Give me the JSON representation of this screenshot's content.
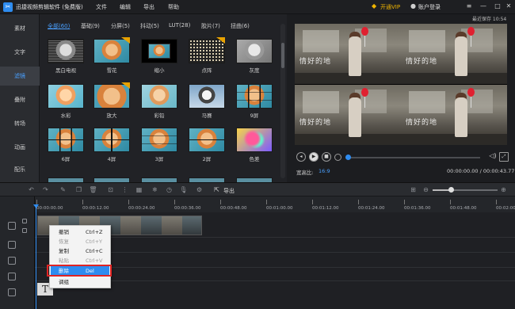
{
  "app": {
    "title": "迅捷视频剪辑软件 (免费版)",
    "menus": [
      "文件",
      "编辑",
      "导出",
      "帮助"
    ],
    "vip": "开通VIP",
    "login": "账户登录",
    "save_status": "最近保存 10:54"
  },
  "sidebar": {
    "items": [
      {
        "label": "素材"
      },
      {
        "label": "文字"
      },
      {
        "label": "滤镜",
        "active": true
      },
      {
        "label": "叠附"
      },
      {
        "label": "转场"
      },
      {
        "label": "动画"
      },
      {
        "label": "配乐"
      }
    ]
  },
  "library": {
    "tabs": [
      {
        "label": "全部(60)",
        "active": true
      },
      {
        "label": "基础(9)"
      },
      {
        "label": "分屏(5)"
      },
      {
        "label": "抖动(5)"
      },
      {
        "label": "LUT(28)"
      },
      {
        "label": "胶片(7)"
      },
      {
        "label": "扭曲(6)"
      }
    ],
    "filters": [
      {
        "label": "黑白电视",
        "style": "bw-tv",
        "badge": false
      },
      {
        "label": "雪花",
        "style": "snow",
        "badge": true
      },
      {
        "label": "缩小",
        "style": "shrink",
        "badge": false
      },
      {
        "label": "点阵",
        "style": "dots",
        "badge": true
      },
      {
        "label": "灰度",
        "style": "gray",
        "badge": false
      },
      {
        "label": "水彩",
        "style": "watercolor",
        "badge": false
      },
      {
        "label": "放大",
        "style": "zoom",
        "badge": true
      },
      {
        "label": "彩铅",
        "style": "pencil",
        "badge": false
      },
      {
        "label": "马赛",
        "style": "mosaic",
        "badge": false
      },
      {
        "label": "9屏",
        "style": "grid9",
        "badge": false
      },
      {
        "label": "6屏",
        "style": "grid6",
        "badge": false
      },
      {
        "label": "4屏",
        "style": "grid4",
        "badge": false
      },
      {
        "label": "3屏",
        "style": "grid3",
        "badge": false
      },
      {
        "label": "2屏",
        "style": "grid2",
        "badge": false
      },
      {
        "label": "色差",
        "style": "chroma",
        "badge": false
      }
    ]
  },
  "preview": {
    "watermark": "情好的地",
    "ratio_label": "宽高比:",
    "ratio_value": "16:9",
    "timecode": "00:00:00.00 / 00:00:43.77",
    "progress": 0.0
  },
  "toolbar": {
    "export_label": "导出"
  },
  "timeline": {
    "ticks": [
      "00:00:00.00",
      "00:00:12.00",
      "00:00:24.00",
      "00:00:36.00",
      "00:00:48.00",
      "00:01:00.00",
      "00:01:12.00",
      "00:01:24.00",
      "00:01:36.00",
      "00:01:48.00",
      "00:02:00.00"
    ],
    "text_clip": "T"
  },
  "context_menu": {
    "items": [
      {
        "label": "撤销",
        "shortcut": "Ctrl+Z",
        "disabled": false,
        "highlight": false
      },
      {
        "label": "恢复",
        "shortcut": "Ctrl+Y",
        "disabled": true,
        "highlight": false
      },
      {
        "label": "复制",
        "shortcut": "Ctrl+C",
        "disabled": false,
        "highlight": false
      },
      {
        "label": "粘贴",
        "shortcut": "Ctrl+V",
        "disabled": true,
        "highlight": false
      },
      {
        "label": "删除",
        "shortcut": "Del",
        "disabled": false,
        "highlight": true
      },
      {
        "label": "调组",
        "shortcut": "",
        "disabled": false,
        "highlight": false
      }
    ]
  },
  "colors": {
    "accent": "#2e8cf0",
    "highlight_box": "#e02424",
    "vip": "#f0b400"
  }
}
